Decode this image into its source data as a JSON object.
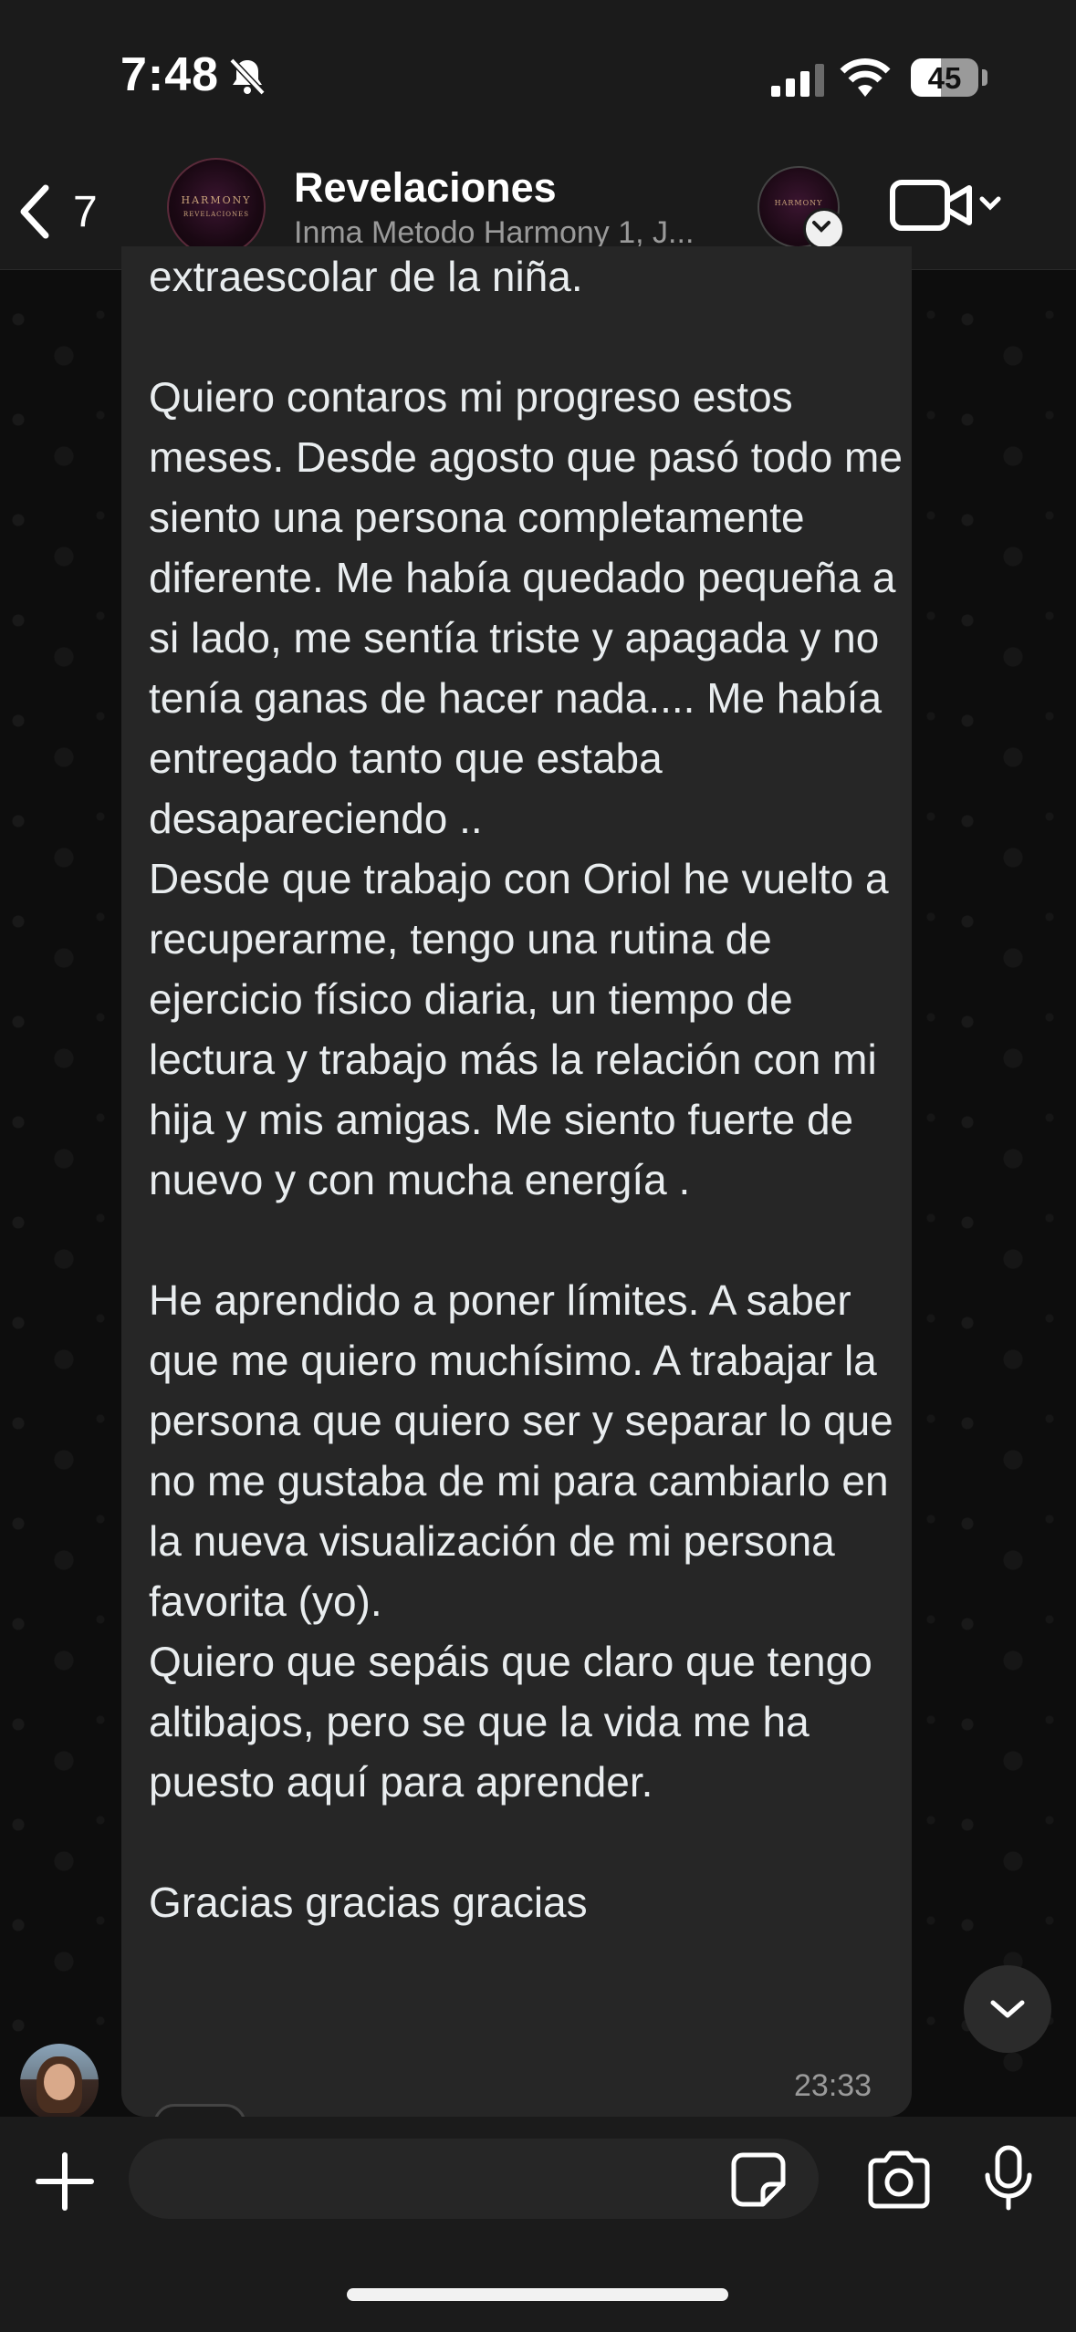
{
  "status_bar": {
    "time": "7:48",
    "battery_percent": "45",
    "battery_level": 0.45
  },
  "header": {
    "back_count": "7",
    "group_name": "Revelaciones",
    "members": "Inma Metodo Harmony 1, J...",
    "avatar_text_top": "HARMONY",
    "avatar_text_bottom": "REVELACIONES",
    "status_avatar_text": "HARMONY"
  },
  "message": {
    "text": "extraescolar de la niña.\n\nQuiero contaros mi progreso estos meses. Desde agosto que pasó todo me siento una persona completamente diferente. Me había quedado pequeña a si lado, me sentía triste y apagada y no tenía ganas de hacer nada.... Me había entregado tanto que estaba desapareciendo ..\nDesde que trabajo con Oriol he vuelto a recuperarme, tengo una rutina de ejercicio físico diaria, un tiempo de lectura y trabajo más la relación con mi hija y mis amigas. Me siento fuerte de nuevo y con mucha energía .\n\nHe aprendido a poner límites. A saber que me quiero muchísimo. A trabajar la persona que quiero ser y separar lo que no me gustaba de mi para cambiarlo en la nueva visualización de mi persona favorita (yo).\nQuiero que sepáis que claro que tengo altibajos, pero se que la vida me ha puesto aquí para aprender.\n\nGracias gracias gracias",
    "time": "23:33"
  },
  "input": {
    "placeholder": ""
  },
  "icons": {
    "back": "chevron-left-icon",
    "mute": "bell-slash-icon",
    "video": "video-camera-icon",
    "plus": "plus-icon",
    "sticker": "sticker-icon",
    "camera": "camera-icon",
    "mic": "microphone-icon",
    "scroll": "chevron-down-icon"
  }
}
